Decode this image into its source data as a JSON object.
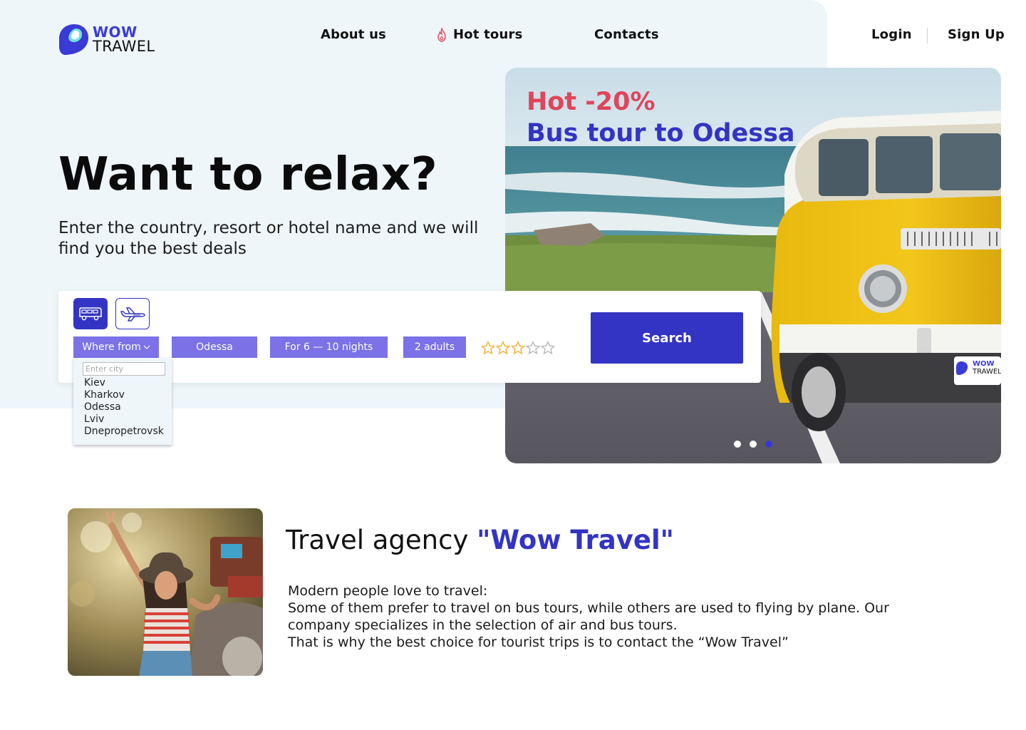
{
  "brand": {
    "line1": "WOW",
    "line2": "TRAWEL",
    "accent": "#3a3ad6"
  },
  "nav": {
    "about": "About us",
    "hot_tours": "Hot tours",
    "contacts": "Contacts",
    "login": "Login",
    "signup": "Sign Up"
  },
  "hero": {
    "headline": "Want to relax?",
    "subtitle": "Enter the  country, resort or hotel name and we will find you the best deals"
  },
  "search": {
    "modes": [
      {
        "icon": "bus-icon",
        "active": true
      },
      {
        "icon": "plane-icon",
        "active": false
      }
    ],
    "from_label": "Where from",
    "to_value": "Odessa",
    "nights_value": "For 6 — 10 nights",
    "adults_value": "2 adults",
    "rating": {
      "filled": 3,
      "max": 5
    },
    "button_label": "Search",
    "dropdown": {
      "placeholder": "Enter city",
      "cities": [
        "Kiev",
        "Kharkov",
        "Odessa",
        "Lviv",
        "Dnepropetrovsk"
      ]
    }
  },
  "promo": {
    "discount": "Hot -20%",
    "title": "Bus tour to Odessa",
    "plate_line1": "WOW",
    "plate_line2": "TRAWEL",
    "slides": 3,
    "active_slide": 3
  },
  "about": {
    "title_prefix": "Travel agency ",
    "title_accent": "\"Wow Travel\"",
    "text": [
      "Modern people love to travel:",
      "Some of them prefer to travel on bus tours, while others are used to flying by plane. Our company specializes in the selection of air and bus tours.",
      "That is why the best choice for tourist trips is to contact the “Wow Travel”"
    ]
  },
  "colors": {
    "primary": "#3434c4",
    "chip": "#7a72e6",
    "hot": "#e0455a",
    "hero_bg": "#eef6fa",
    "star": "#f2b134"
  }
}
